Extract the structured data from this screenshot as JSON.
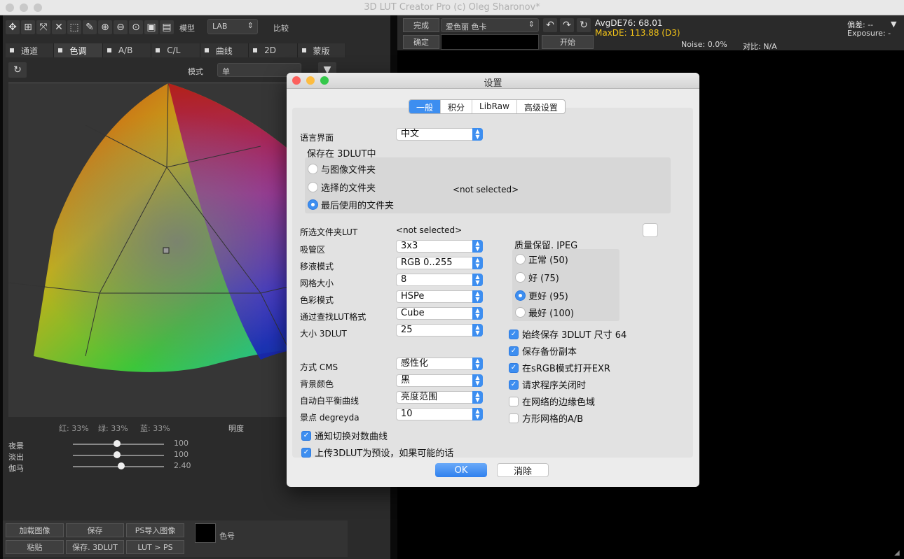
{
  "window": {
    "title": "3D LUT Creator Pro (c) Oleg Sharonov*"
  },
  "left": {
    "model_label": "模型",
    "model_value": "LAB",
    "compare_label": "比较",
    "tabs": [
      "通道",
      "色调",
      "A/B",
      "C/L",
      "曲线",
      "2D",
      "蒙版"
    ],
    "mode_label": "模式",
    "mode_value": "单",
    "rgb_readout": {
      "r": "红: 33%",
      "g": "绿: 33%",
      "b": "蓝: 33%"
    },
    "brightness_label": "明度",
    "sliders": [
      {
        "label": "夜景",
        "value": "100"
      },
      {
        "label": "淡出",
        "value": "100"
      },
      {
        "label": "伽马",
        "value": "2.40"
      }
    ],
    "buttons_row1": [
      "加载图像",
      "保存",
      "PS导入图像"
    ],
    "buttons_row2": [
      "粘贴",
      "保存. 3DLUT",
      "LUT > PS"
    ],
    "color_label": "色号"
  },
  "right": {
    "done": "完成",
    "preset": "爱色丽 色卡",
    "confirm": "确定",
    "start": "开始",
    "avg": "AvgDE76: 68.01",
    "max": "MaxDE: 113.88 (D3)",
    "noise": "Noise: 0.0%",
    "contrast": "对比: N/A",
    "deviation": "偏差: --",
    "exposure": "Exposure: -"
  },
  "dialog": {
    "title": "设置",
    "tabs": [
      "一般",
      "积分",
      "LibRaw",
      "高级设置"
    ],
    "language_label": "语言界面",
    "language_value": "中文",
    "save_group_label": "保存在 3DLUT中",
    "save_options": [
      "与图像文件夹",
      "选择的文件夹",
      "最后使用的文件夹"
    ],
    "not_selected_1": "<not selected>",
    "selected_folder_label": "所选文件夹LUT",
    "not_selected_2": "<not selected>",
    "fields": [
      {
        "label": "吸管区",
        "value": "3x3"
      },
      {
        "label": "移液模式",
        "value": "RGB 0..255"
      },
      {
        "label": "网格大小",
        "value": "8"
      },
      {
        "label": "色彩模式",
        "value": "HSPe"
      },
      {
        "label": "通过查找LUT格式",
        "value": "Cube"
      },
      {
        "label": "大小 3DLUT",
        "value": "25"
      }
    ],
    "fields2": [
      {
        "label": "方式 CMS",
        "value": "感性化"
      },
      {
        "label": "背景颜色",
        "value": "黑"
      },
      {
        "label": "自动白平衡曲线",
        "value": "亮度范围"
      },
      {
        "label": "景点 degreyda",
        "value": "10"
      }
    ],
    "jpeg_label": "质量保留. JPEG",
    "jpeg_options": [
      "正常 (50)",
      "好 (75)",
      "更好 (95)",
      "最好 (100)"
    ],
    "checks_right": [
      {
        "label": "始终保存 3DLUT 尺寸 64",
        "on": true
      },
      {
        "label": "保存备份副本",
        "on": true
      },
      {
        "label": "在sRGB模式打开EXR",
        "on": true
      },
      {
        "label": "请求程序关闭时",
        "on": true
      },
      {
        "label": "在网络的边缘色域",
        "on": false
      },
      {
        "label": "方形网格的A/B",
        "on": false
      }
    ],
    "checks_left": [
      {
        "label": "通知切换对数曲线",
        "on": true
      },
      {
        "label": "上传3DLUT为预设，如果可能的话",
        "on": true
      }
    ],
    "ok": "OK",
    "cancel": "消除"
  },
  "colors": {
    "accent": "#3d8ef0"
  }
}
